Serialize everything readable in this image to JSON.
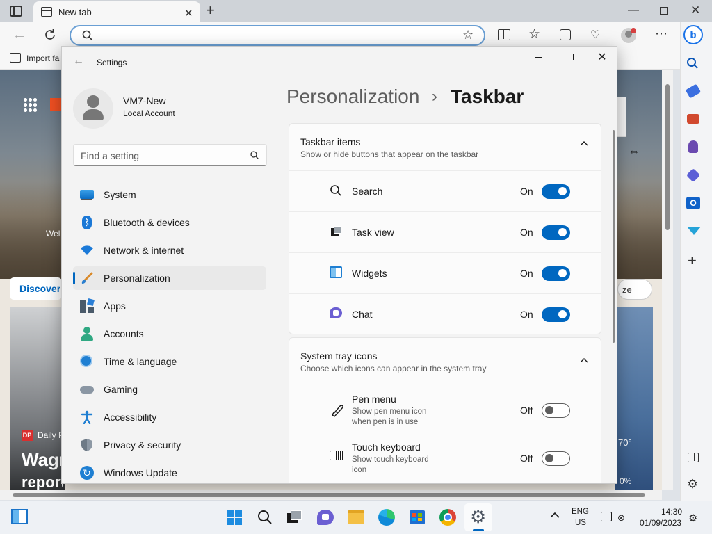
{
  "browser": {
    "tab_title": "New tab",
    "favorites_bar_text": "Import fa",
    "address_placeholder": ""
  },
  "background_page": {
    "discover_label": "Discover",
    "welcome_text": "Wel",
    "news_source": "Daily P",
    "news_source_badge": "DP",
    "headline": "Wagr",
    "headline_line2": "reports of his elimination in new video",
    "side_button": "ze",
    "weather_temp": "70°",
    "weather_pct": "0%"
  },
  "settings": {
    "app_title": "Settings",
    "user": {
      "name": "VM7-New",
      "account_type": "Local Account"
    },
    "search_placeholder": "Find a setting",
    "breadcrumb_parent": "Personalization",
    "breadcrumb_separator": "›",
    "page_title": "Taskbar",
    "nav": [
      {
        "label": "System",
        "icon": "system-icon"
      },
      {
        "label": "Bluetooth & devices",
        "icon": "bluetooth-icon"
      },
      {
        "label": "Network & internet",
        "icon": "wifi-icon"
      },
      {
        "label": "Personalization",
        "icon": "brush-icon",
        "selected": true
      },
      {
        "label": "Apps",
        "icon": "apps-icon"
      },
      {
        "label": "Accounts",
        "icon": "accounts-icon"
      },
      {
        "label": "Time & language",
        "icon": "clock-icon"
      },
      {
        "label": "Gaming",
        "icon": "gamepad-icon"
      },
      {
        "label": "Accessibility",
        "icon": "accessibility-icon"
      },
      {
        "label": "Privacy & security",
        "icon": "shield-icon"
      },
      {
        "label": "Windows Update",
        "icon": "update-icon"
      }
    ],
    "taskbar_items": {
      "title": "Taskbar items",
      "subtitle": "Show or hide buttons that appear on the taskbar",
      "rows": [
        {
          "label": "Search",
          "state": "On",
          "on": true,
          "icon": "search-icon"
        },
        {
          "label": "Task view",
          "state": "On",
          "on": true,
          "icon": "task-view-icon"
        },
        {
          "label": "Widgets",
          "state": "On",
          "on": true,
          "icon": "widgets-icon"
        },
        {
          "label": "Chat",
          "state": "On",
          "on": true,
          "icon": "chat-icon"
        }
      ]
    },
    "system_tray": {
      "title": "System tray icons",
      "subtitle": "Choose which icons can appear in the system tray",
      "rows": [
        {
          "label": "Pen menu",
          "desc": "Show pen menu icon when pen is in use",
          "state": "Off",
          "on": false,
          "icon": "pen-icon"
        },
        {
          "label": "Touch keyboard",
          "desc": "Show touch keyboard icon",
          "state": "Off",
          "on": false,
          "icon": "keyboard-icon"
        }
      ]
    }
  },
  "taskbar": {
    "lang_top": "ENG",
    "lang_bottom": "US",
    "time": "14:30",
    "date": "01/09/2023"
  },
  "colors": {
    "accent": "#0067c0",
    "edge_blue": "#1a73e8"
  }
}
